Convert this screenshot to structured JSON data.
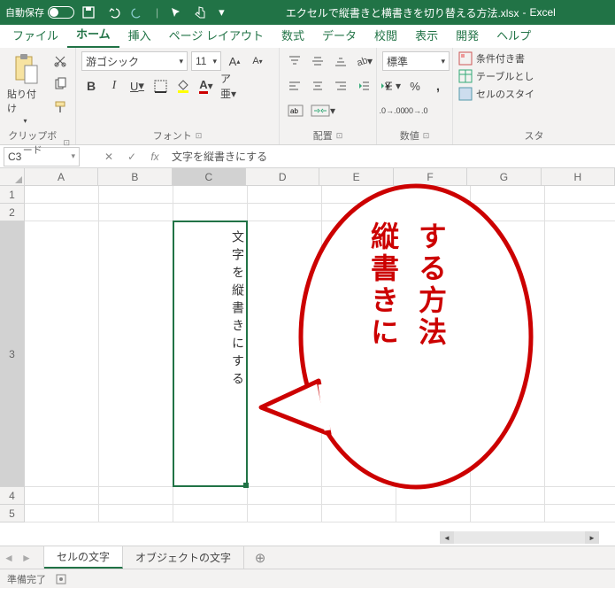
{
  "titlebar": {
    "autosave_label": "自動保存",
    "autosave_state": "オフ",
    "filename": "エクセルで縦書きと横書きを切り替える方法.xlsx",
    "app": "Excel"
  },
  "tabs": {
    "file": "ファイル",
    "home": "ホーム",
    "insert": "挿入",
    "pagelayout": "ページ レイアウト",
    "formulas": "数式",
    "data": "データ",
    "review": "校閲",
    "view": "表示",
    "developer": "開発",
    "help": "ヘルプ"
  },
  "ribbon": {
    "clipboard": {
      "label": "クリップボード",
      "paste": "貼り付け"
    },
    "font": {
      "label": "フォント",
      "name": "游ゴシック",
      "size": "11",
      "bold": "B",
      "italic": "I",
      "underline": "U"
    },
    "alignment": {
      "label": "配置"
    },
    "number": {
      "label": "数値",
      "format": "標準",
      "percent": "%",
      "comma": ","
    },
    "styles": {
      "label": "スタ",
      "cond": "条件付き書",
      "table": "テーブルとし",
      "cell": "セルのスタイ"
    }
  },
  "formula_bar": {
    "namebox": "C3",
    "fx": "fx",
    "value": "文字を縦書きにする"
  },
  "grid": {
    "cols": [
      "A",
      "B",
      "C",
      "D",
      "E",
      "F",
      "G",
      "H"
    ],
    "rows": [
      "1",
      "2",
      "3",
      "4",
      "5"
    ],
    "active": "C3",
    "c3_text": "文字を縦書きにする"
  },
  "callout": {
    "line1": "縦書きに",
    "line2": "する方法"
  },
  "sheet_tabs": {
    "t1": "セルの文字",
    "t2": "オブジェクトの文字",
    "add": "+"
  },
  "status": {
    "ready": "準備完了"
  }
}
